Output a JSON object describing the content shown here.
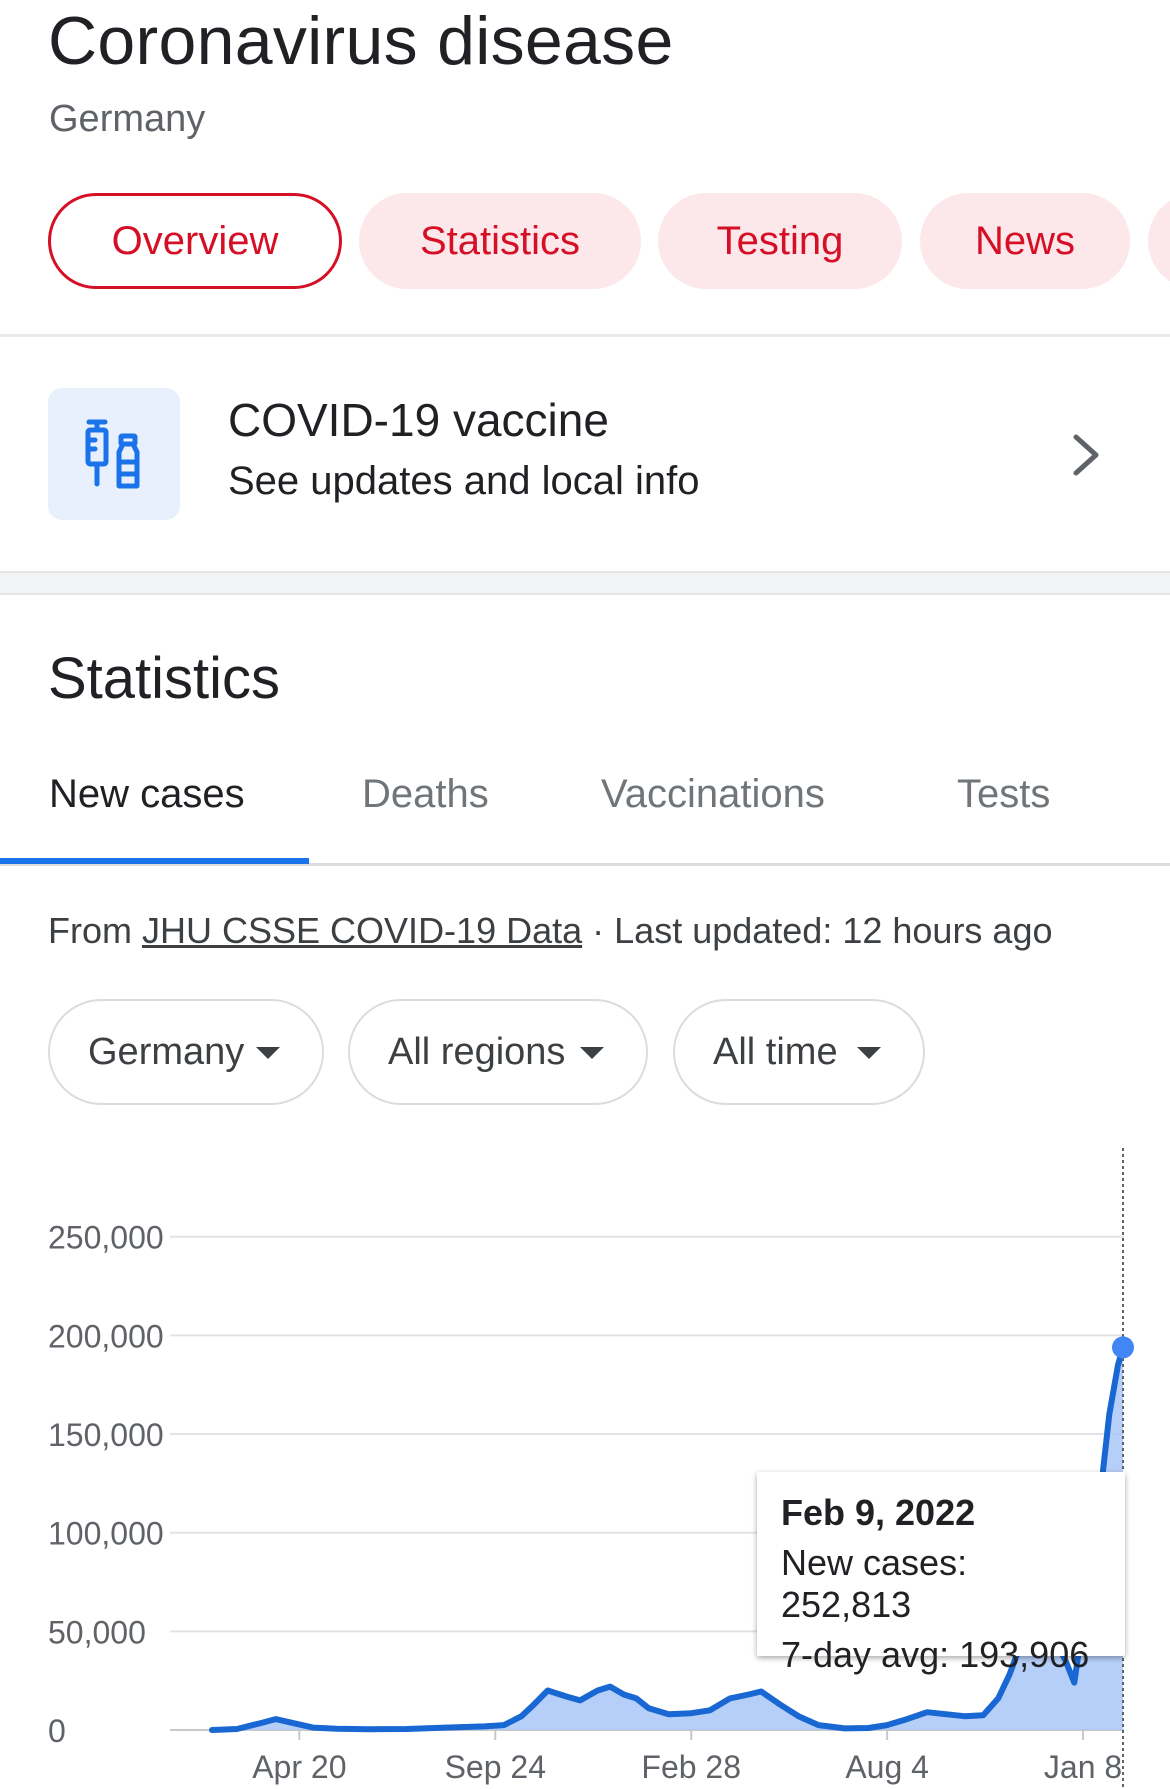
{
  "header": {
    "title": "Coronavirus disease",
    "subtitle": "Germany"
  },
  "chips": [
    {
      "label": "Overview",
      "active": true
    },
    {
      "label": "Statistics",
      "active": false
    },
    {
      "label": "Testing",
      "active": false
    },
    {
      "label": "News",
      "active": false
    }
  ],
  "vaccine_card": {
    "title": "COVID-19 vaccine",
    "subtitle": "See updates and local info",
    "icon": "syringe-vial-icon"
  },
  "statistics": {
    "title": "Statistics",
    "tabs": [
      {
        "label": "New cases",
        "active": true
      },
      {
        "label": "Deaths",
        "active": false
      },
      {
        "label": "Vaccinations",
        "active": false
      },
      {
        "label": "Tests",
        "active": false
      }
    ],
    "source": {
      "prefix": "From",
      "link_text": "JHU CSSE COVID-19 Data",
      "suffix": "· Last updated: 12 hours ago"
    },
    "filters": [
      {
        "label": "Germany"
      },
      {
        "label": "All regions"
      },
      {
        "label": "All time"
      }
    ]
  },
  "colors": {
    "accent_red": "#d50f25",
    "chip_bg": "#fce8ea",
    "line_blue": "#1967d2",
    "bar_blue": "#a9c7f7",
    "tab_blue": "#1a73e8"
  },
  "tooltip": {
    "date": "Feb 9, 2022",
    "new_cases": "New cases: 252,813",
    "avg": "7-day avg: 193,906"
  },
  "chart_data": {
    "type": "area",
    "ylim": [
      0,
      260000
    ],
    "yticks": [
      0,
      50000,
      100000,
      150000,
      200000,
      250000
    ],
    "ytick_labels": [
      "0",
      "50,000",
      "100,000",
      "150,000",
      "200,000",
      "250,000"
    ],
    "xtick_labels": [
      "Apr 20",
      "Sep 24",
      "Feb 28",
      "Aug 4",
      "Jan 8"
    ],
    "xtick_dates": [
      "2020-04-20",
      "2020-09-24",
      "2021-02-28",
      "2021-08-04",
      "2022-01-08"
    ],
    "x_range": [
      "2020-02-10",
      "2022-02-09"
    ],
    "series": [
      {
        "x": [
          "2020-02-10",
          "2020-03-01",
          "2020-03-20",
          "2020-04-01",
          "2020-04-15",
          "2020-05-01",
          "2020-05-20",
          "2020-06-15",
          "2020-07-15",
          "2020-08-15",
          "2020-09-15",
          "2020-10-01",
          "2020-10-15",
          "2020-10-25",
          "2020-11-05",
          "2020-11-20",
          "2020-12-01",
          "2020-12-15",
          "2020-12-25",
          "2021-01-05",
          "2021-01-15",
          "2021-01-25",
          "2021-02-10",
          "2021-02-28",
          "2021-03-15",
          "2021-03-31",
          "2021-04-15",
          "2021-04-25",
          "2021-05-10",
          "2021-05-25",
          "2021-06-10",
          "2021-07-01",
          "2021-07-20",
          "2021-08-04",
          "2021-08-20",
          "2021-09-05",
          "2021-09-20",
          "2021-10-05",
          "2021-10-20",
          "2021-11-01",
          "2021-11-10",
          "2021-11-20",
          "2021-11-28",
          "2021-12-05",
          "2021-12-15",
          "2021-12-25",
          "2022-01-01",
          "2022-01-08",
          "2022-01-15",
          "2022-01-22",
          "2022-01-29",
          "2022-02-05",
          "2022-02-09"
        ],
        "values": [
          0,
          500,
          3500,
          5500,
          3500,
          1200,
          600,
          400,
          500,
          1200,
          1800,
          2500,
          7000,
          13000,
          20000,
          17000,
          15000,
          20000,
          22000,
          18000,
          16000,
          11000,
          8000,
          8500,
          10000,
          16000,
          18000,
          19500,
          13000,
          7000,
          2500,
          800,
          1000,
          2500,
          5500,
          9000,
          8000,
          7000,
          7500,
          16000,
          28000,
          45000,
          58000,
          60000,
          48000,
          35000,
          24000,
          55000,
          80000,
          120000,
          160000,
          185000,
          193906
        ]
      }
    ],
    "highlight": {
      "x": "2022-02-09",
      "new_cases": 252813,
      "avg": 193906
    }
  }
}
